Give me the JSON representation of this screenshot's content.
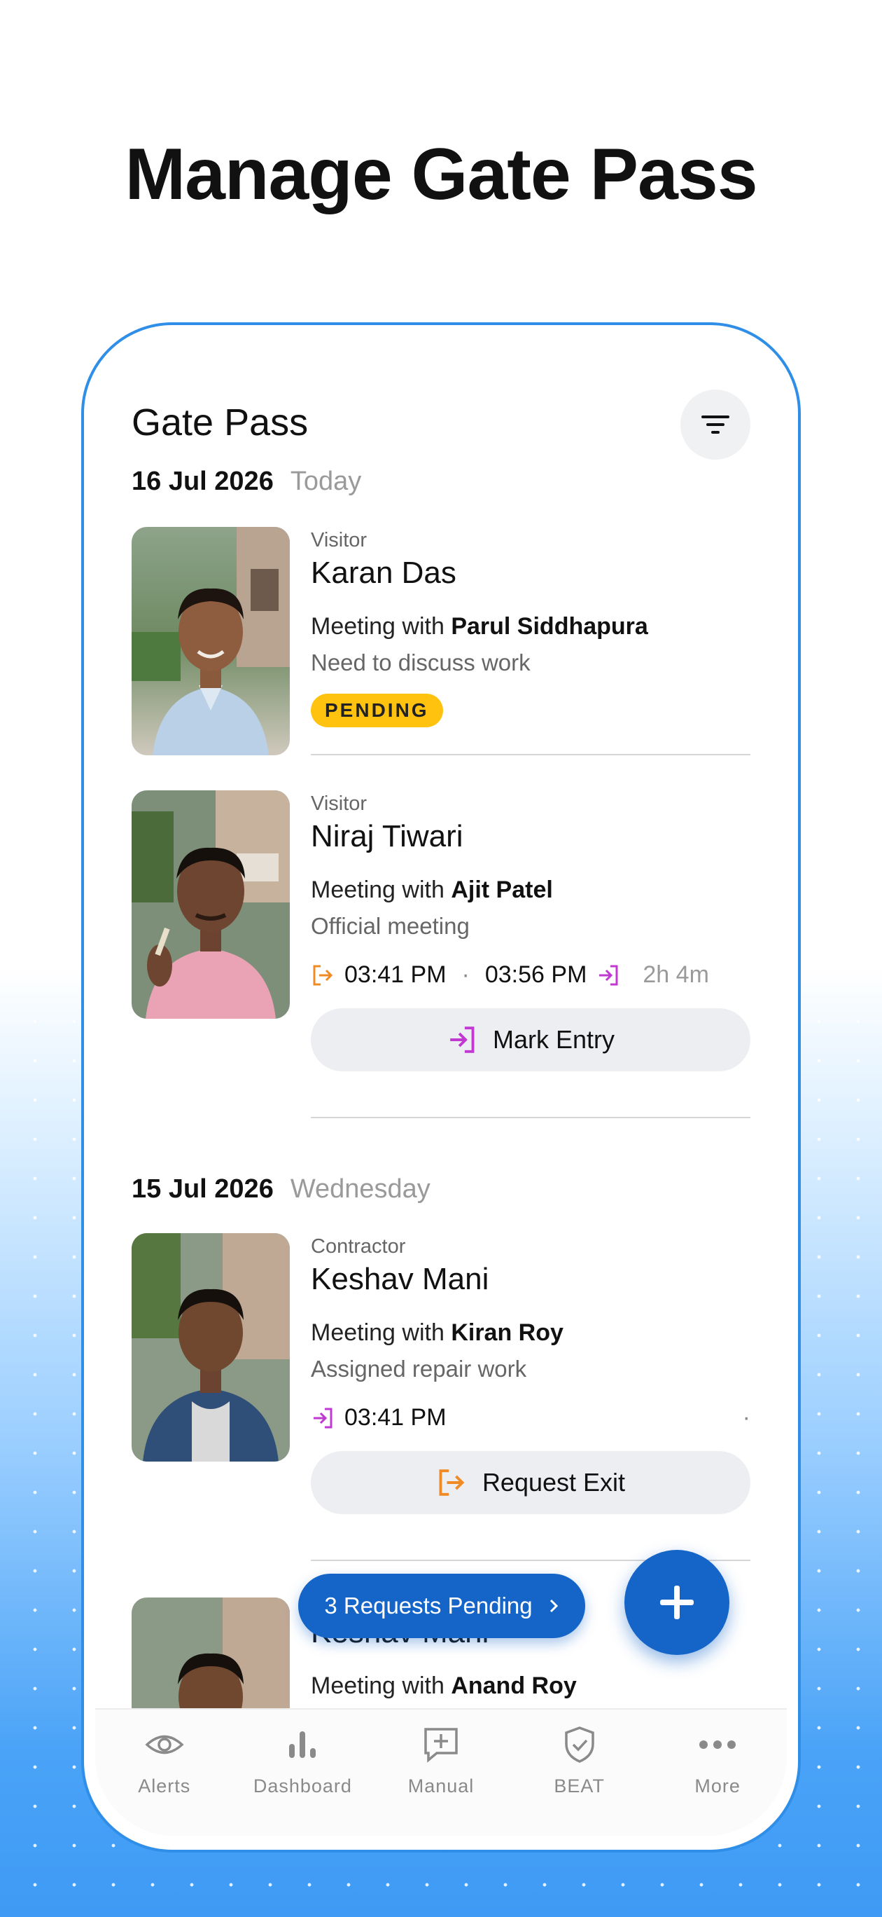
{
  "headline": "Manage Gate Pass",
  "screen": {
    "title": "Gate Pass",
    "filter_icon": "filter-icon",
    "groups": [
      {
        "date": "16 Jul 2026",
        "weekday": "Today",
        "cards": [
          {
            "role": "Visitor",
            "name": "Karan Das",
            "meeting_prefix": "Meeting with",
            "host": "Parul Siddhapura",
            "purpose": "Need to discuss work",
            "status": "PENDING"
          },
          {
            "role": "Visitor",
            "name": "Niraj Tiwari",
            "meeting_prefix": "Meeting with",
            "host": "Ajit Patel",
            "purpose": "Official meeting",
            "exit_time": "03:41 PM",
            "separator": "·",
            "entry_time": "03:56 PM",
            "duration": "2h 4m",
            "action": "Mark Entry"
          }
        ]
      },
      {
        "date": "15 Jul 2026",
        "weekday": "Wednesday",
        "cards": [
          {
            "role": "Contractor",
            "name": "Keshav Mani",
            "meeting_prefix": "Meeting with",
            "host": "Kiran Roy",
            "purpose": "Assigned repair work",
            "entry_time": "03:41 PM",
            "dot": "·",
            "action": "Request Exit"
          },
          {
            "name": "Keshav Mani",
            "meeting_prefix": "Meeting with",
            "host": "Anand Roy"
          }
        ]
      }
    ],
    "pending_pill": "3 Requests Pending",
    "fab_icon": "plus-icon",
    "nav": [
      {
        "label": "Alerts",
        "icon": "eye-alert-icon"
      },
      {
        "label": "Dashboard",
        "icon": "bar-chart-icon"
      },
      {
        "label": "Manual",
        "icon": "add-message-icon"
      },
      {
        "label": "BEAT",
        "icon": "shield-check-icon"
      },
      {
        "label": "More",
        "icon": "more-dots-icon"
      }
    ]
  },
  "colors": {
    "accent": "#1565c9",
    "device_border": "#2e8ee8",
    "pending_badge": "#ffc20e",
    "exit_icon": "#f08a24",
    "entry_icon": "#c03ad1"
  }
}
